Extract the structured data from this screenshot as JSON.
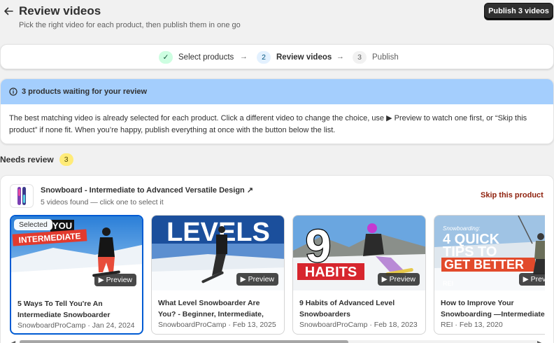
{
  "header": {
    "title": "Review videos",
    "subtitle": "Pick the right video for each product, then publish them in one go",
    "publish_label": "Publish 3 videos"
  },
  "stepper": {
    "steps": [
      {
        "num": "✓",
        "label": "Select products",
        "state": "done"
      },
      {
        "num": "2",
        "label": "Review videos",
        "state": "active"
      },
      {
        "num": "3",
        "label": "Publish",
        "state": "todo"
      }
    ],
    "arrow": "→"
  },
  "banner": {
    "title": "3 products waiting for your review",
    "body": "The best matching video is already selected for each product. Click a different video to change the choice, use ▶ Preview to watch one first, or “Skip this product” if none fit. When you’re happy, publish everything at once with the button below the list."
  },
  "section": {
    "title": "Needs review",
    "count": "3"
  },
  "product": {
    "title": "Snowboard - Intermediate to Advanced Versatile Design ↗",
    "subtitle": "5 videos found — click one to select it",
    "skip_label": "Skip this product"
  },
  "videos": [
    {
      "title": "5 Ways To Tell You're An Intermediate Snowboarder",
      "meta": "SnowboardProCamp · Jan 24, 2024",
      "preview": "▶ Preview",
      "selected_label": "Selected",
      "thumb_text": [
        "YOU",
        "INTERMEDIATE"
      ]
    },
    {
      "title": "What Level Snowboarder Are You? - Beginner, Intermediate, Advanced...",
      "meta": "SnowboardProCamp · Feb 13, 2025",
      "preview": "▶ Preview",
      "thumb_text": [
        "LEVELS"
      ]
    },
    {
      "title": "9 Habits of Advanced Level Snowboarders",
      "meta": "SnowboardProCamp · Feb 18, 2023",
      "preview": "▶ Preview",
      "thumb_text": [
        "9",
        "HABITS"
      ]
    },
    {
      "title": "How to Improve Your Snowboarding —Intermediate Snowboarding Tips",
      "meta": "REI · Feb 13, 2020",
      "preview": "▶ Preview",
      "thumb_text": [
        "Snowboarding:",
        "4 QUICK",
        "TIPS TO",
        "GET BETTER",
        "REI"
      ]
    }
  ],
  "scroll": {
    "left_arrow": "◀",
    "right_arrow": "▶"
  },
  "colors": {
    "primary": "#303030",
    "accent": "#005bd3",
    "banner": "#a4cefd",
    "danger": "#8e1f0b"
  }
}
